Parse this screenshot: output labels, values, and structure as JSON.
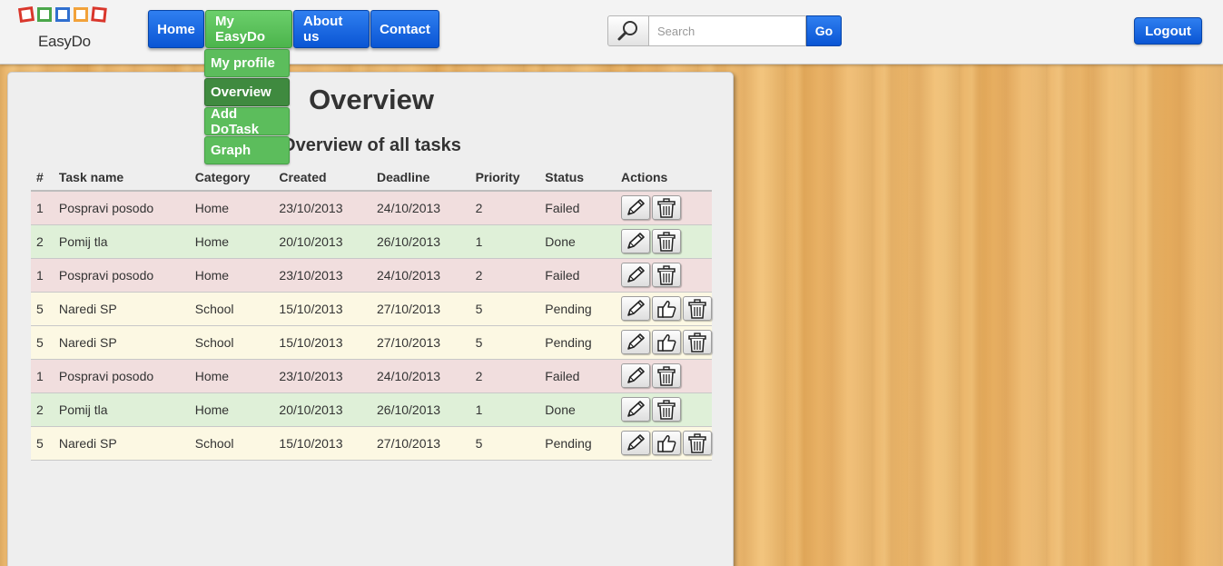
{
  "logo": {
    "text": "EasyDo"
  },
  "nav": {
    "items": [
      {
        "label": "Home"
      },
      {
        "label": "My EasyDo"
      },
      {
        "label": "About us"
      },
      {
        "label": "Contact"
      }
    ],
    "dropdown": [
      {
        "label": "My profile"
      },
      {
        "label": "Overview"
      },
      {
        "label": "Add DoTask"
      },
      {
        "label": "Graph"
      }
    ]
  },
  "search": {
    "placeholder": "Search",
    "value": "",
    "button_label": "Go"
  },
  "logout_label": "Logout",
  "main": {
    "title": "Overview",
    "subtitle": "Overview of all tasks",
    "columns": [
      "#",
      "Task name",
      "Category",
      "Created",
      "Deadline",
      "Priority",
      "Status",
      "Actions"
    ],
    "rows": [
      {
        "id": "1",
        "name": "Pospravi posodo",
        "category": "Home",
        "created": "23/10/2013",
        "deadline": "24/10/2013",
        "priority": "2",
        "status": "Failed"
      },
      {
        "id": "2",
        "name": "Pomij tla",
        "category": "Home",
        "created": "20/10/2013",
        "deadline": "26/10/2013",
        "priority": "1",
        "status": "Done"
      },
      {
        "id": "1",
        "name": "Pospravi posodo",
        "category": "Home",
        "created": "23/10/2013",
        "deadline": "24/10/2013",
        "priority": "2",
        "status": "Failed"
      },
      {
        "id": "5",
        "name": "Naredi SP",
        "category": "School",
        "created": "15/10/2013",
        "deadline": "27/10/2013",
        "priority": "5",
        "status": "Pending"
      },
      {
        "id": "5",
        "name": "Naredi SP",
        "category": "School",
        "created": "15/10/2013",
        "deadline": "27/10/2013",
        "priority": "5",
        "status": "Pending"
      },
      {
        "id": "1",
        "name": "Pospravi posodo",
        "category": "Home",
        "created": "23/10/2013",
        "deadline": "24/10/2013",
        "priority": "2",
        "status": "Failed"
      },
      {
        "id": "2",
        "name": "Pomij tla",
        "category": "Home",
        "created": "20/10/2013",
        "deadline": "26/10/2013",
        "priority": "1",
        "status": "Done"
      },
      {
        "id": "5",
        "name": "Naredi SP",
        "category": "School",
        "created": "15/10/2013",
        "deadline": "27/10/2013",
        "priority": "5",
        "status": "Pending"
      }
    ]
  },
  "icons": {
    "search": "search-icon",
    "edit": "pencil-icon",
    "approve": "thumbs-up-icon",
    "delete": "trash-icon"
  },
  "colors": {
    "nav_blue": "#0a55d4",
    "nav_green": "#5cbd5c",
    "row_failed": "#f1dede",
    "row_done": "#dff0d8",
    "row_pending": "#fcf8e3"
  }
}
